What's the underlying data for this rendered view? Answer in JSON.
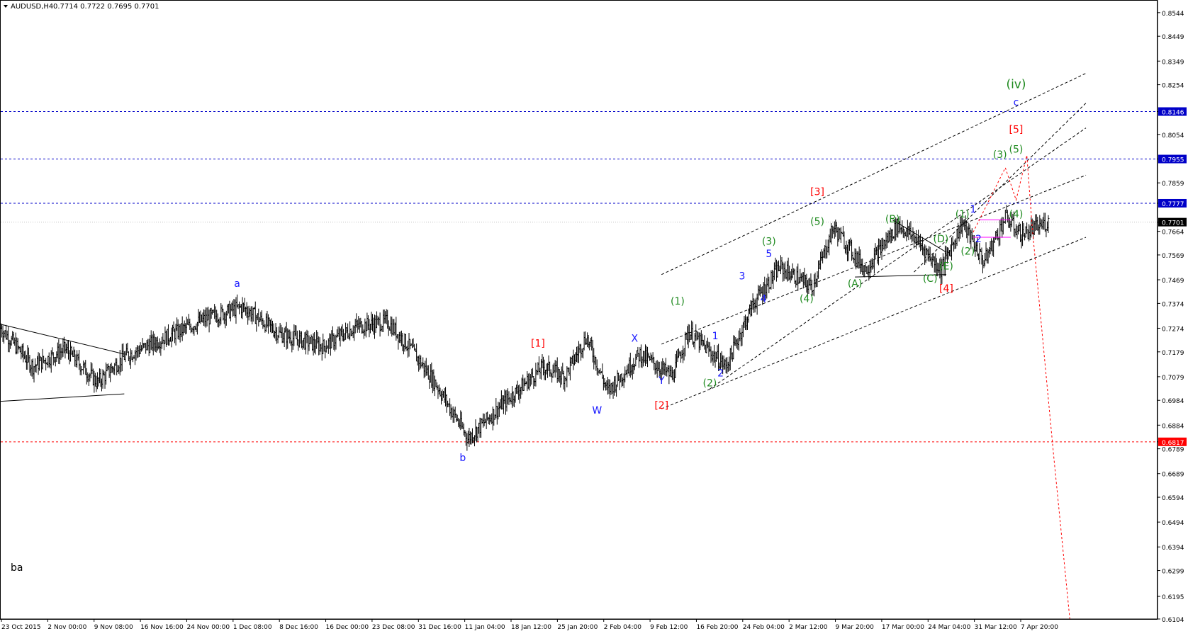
{
  "header": {
    "symbol": "AUDUSD,H4",
    "ohlc": "0.7714 0.7722 0.7695 0.7701"
  },
  "watermark": "ba",
  "colors": {
    "bars": "#000000",
    "hline_blue": "#0000c8",
    "hline_red": "#ff0000",
    "label_blue": "#1a1aff",
    "label_green": "#1f8a1f",
    "label_red": "#ff0000",
    "current_price_bg": "#000000",
    "highlight": "#ff00ff"
  },
  "chart_data": {
    "type": "candlestick-bars",
    "title": "AUDUSD,H4",
    "ylim": [
      0.6104,
      0.8592
    ],
    "y_ticks": [
      "0.8544",
      "0.8449",
      "0.8349",
      "0.8254",
      "0.8146",
      "0.8054",
      "0.7955",
      "0.7859",
      "0.7777",
      "0.7701",
      "0.7664",
      "0.7569",
      "0.7469",
      "0.7374",
      "0.7274",
      "0.7179",
      "0.7079",
      "0.6984",
      "0.6884",
      "0.6817",
      "0.6789",
      "0.6689",
      "0.6594",
      "0.6494",
      "0.6394",
      "0.6299",
      "0.6195",
      "0.6104"
    ],
    "x_ticks": [
      "23 Oct 2015",
      "2 Nov 00:00",
      "9 Nov 08:00",
      "16 Nov 16:00",
      "24 Nov 00:00",
      "1 Dec 08:00",
      "8 Dec 16:00",
      "16 Dec 00:00",
      "23 Dec 08:00",
      "31 Dec 16:00",
      "11 Jan 04:00",
      "18 Jan 12:00",
      "25 Jan 20:00",
      "2 Feb 04:00",
      "9 Feb 12:00",
      "16 Feb 20:00",
      "24 Feb 04:00",
      "2 Mar 12:00",
      "9 Mar 20:00",
      "17 Mar 00:00",
      "24 Mar 04:00",
      "31 Mar 12:00",
      "7 Apr 20:00"
    ],
    "price_series_knots": [
      {
        "t": 0,
        "p": 0.7275
      },
      {
        "t": 6,
        "p": 0.712
      },
      {
        "t": 12,
        "p": 0.719
      },
      {
        "t": 18,
        "p": 0.7055
      },
      {
        "t": 23,
        "p": 0.716
      },
      {
        "t": 30,
        "p": 0.723
      },
      {
        "t": 38,
        "p": 0.731
      },
      {
        "t": 45,
        "p": 0.736
      },
      {
        "t": 52,
        "p": 0.725
      },
      {
        "t": 60,
        "p": 0.72
      },
      {
        "t": 66,
        "p": 0.728
      },
      {
        "t": 72,
        "p": 0.73
      },
      {
        "t": 76,
        "p": 0.72
      },
      {
        "t": 81,
        "p": 0.705
      },
      {
        "t": 87,
        "p": 0.683
      },
      {
        "t": 93,
        "p": 0.696
      },
      {
        "t": 101,
        "p": 0.712
      },
      {
        "t": 105,
        "p": 0.708
      },
      {
        "t": 109,
        "p": 0.724
      },
      {
        "t": 113,
        "p": 0.702
      },
      {
        "t": 119,
        "p": 0.717
      },
      {
        "t": 125,
        "p": 0.708
      },
      {
        "t": 128,
        "p": 0.726
      },
      {
        "t": 135,
        "p": 0.712
      },
      {
        "t": 140,
        "p": 0.737
      },
      {
        "t": 145,
        "p": 0.752
      },
      {
        "t": 151,
        "p": 0.744
      },
      {
        "t": 155,
        "p": 0.768
      },
      {
        "t": 161,
        "p": 0.751
      },
      {
        "t": 167,
        "p": 0.769
      },
      {
        "t": 170,
        "p": 0.764
      },
      {
        "t": 175,
        "p": 0.751
      },
      {
        "t": 179,
        "p": 0.77
      },
      {
        "t": 183,
        "p": 0.754
      },
      {
        "t": 187,
        "p": 0.772
      },
      {
        "t": 190,
        "p": 0.765
      },
      {
        "t": 195,
        "p": 0.7701
      }
    ],
    "horizontal_levels": [
      {
        "price": 0.8146,
        "label": "0.8146",
        "style": "blue-dashed"
      },
      {
        "price": 0.7955,
        "label": "0.7955",
        "style": "blue-dashed"
      },
      {
        "price": 0.7777,
        "label": "0.7777",
        "style": "blue-dashed"
      },
      {
        "price": 0.7701,
        "label": "0.7701",
        "style": "current-price"
      },
      {
        "price": 0.6817,
        "label": "0.6817",
        "style": "red-dotted"
      }
    ],
    "wave_labels": [
      {
        "text": "a",
        "t": 44,
        "p": 0.744,
        "color": "blue"
      },
      {
        "text": "b",
        "t": 86,
        "p": 0.674,
        "color": "blue"
      },
      {
        "text": "[1]",
        "t": 100,
        "p": 0.72,
        "color": "red"
      },
      {
        "text": "W",
        "t": 111,
        "p": 0.693,
        "color": "blue"
      },
      {
        "text": "X",
        "t": 118,
        "p": 0.722,
        "color": "blue"
      },
      {
        "text": "Y",
        "t": 123,
        "p": 0.705,
        "color": "blue"
      },
      {
        "text": "[2]",
        "t": 123,
        "p": 0.695,
        "color": "red"
      },
      {
        "text": "(1)",
        "t": 126,
        "p": 0.737,
        "color": "green"
      },
      {
        "text": "1",
        "t": 133,
        "p": 0.723,
        "color": "blue"
      },
      {
        "text": "2",
        "t": 134,
        "p": 0.708,
        "color": "blue"
      },
      {
        "text": "(2)",
        "t": 132,
        "p": 0.704,
        "color": "green"
      },
      {
        "text": "3",
        "t": 138,
        "p": 0.747,
        "color": "blue"
      },
      {
        "text": "4",
        "t": 142,
        "p": 0.738,
        "color": "blue"
      },
      {
        "text": "5",
        "t": 143,
        "p": 0.756,
        "color": "blue"
      },
      {
        "text": "(3)",
        "t": 143,
        "p": 0.761,
        "color": "green"
      },
      {
        "text": "(4)",
        "t": 150,
        "p": 0.738,
        "color": "green"
      },
      {
        "text": "(5)",
        "t": 152,
        "p": 0.769,
        "color": "green"
      },
      {
        "text": "[3]",
        "t": 152,
        "p": 0.781,
        "color": "red"
      },
      {
        "text": "(A)",
        "t": 159,
        "p": 0.744,
        "color": "green"
      },
      {
        "text": "(B)",
        "t": 166,
        "p": 0.77,
        "color": "green"
      },
      {
        "text": "(C)",
        "t": 173,
        "p": 0.746,
        "color": "green"
      },
      {
        "text": "(D)",
        "t": 175,
        "p": 0.762,
        "color": "green"
      },
      {
        "text": "(E)",
        "t": 176,
        "p": 0.751,
        "color": "green"
      },
      {
        "text": "[4]",
        "t": 176,
        "p": 0.742,
        "color": "red"
      },
      {
        "text": "(1)",
        "t": 179,
        "p": 0.772,
        "color": "green"
      },
      {
        "text": "1",
        "t": 181,
        "p": 0.774,
        "color": "blue"
      },
      {
        "text": "(2)",
        "t": 180,
        "p": 0.757,
        "color": "green"
      },
      {
        "text": "2",
        "t": 182,
        "p": 0.762,
        "color": "blue"
      },
      {
        "text": "(3)",
        "t": 186,
        "p": 0.796,
        "color": "green"
      },
      {
        "text": "(4)",
        "t": 189,
        "p": 0.772,
        "color": "green"
      },
      {
        "text": "(5)",
        "t": 189,
        "p": 0.798,
        "color": "green"
      },
      {
        "text": "[5]",
        "t": 189,
        "p": 0.806,
        "color": "red"
      },
      {
        "text": "c",
        "t": 189,
        "p": 0.817,
        "color": "blue"
      },
      {
        "text": "(iv)",
        "t": 189,
        "p": 0.824,
        "color": "green"
      }
    ],
    "trend_lines": [
      {
        "t1": 0,
        "p1": 0.729,
        "t2": 23,
        "p2": 0.717,
        "style": "solid"
      },
      {
        "t1": 0,
        "p1": 0.698,
        "t2": 23,
        "p2": 0.701,
        "style": "solid"
      },
      {
        "t1": 166,
        "p1": 0.771,
        "t2": 176,
        "p2": 0.758,
        "style": "solid"
      },
      {
        "t1": 159,
        "p1": 0.748,
        "t2": 176,
        "p2": 0.749,
        "style": "solid"
      },
      {
        "t1": 123,
        "p1": 0.749,
        "t2": 202,
        "p2": 0.83,
        "style": "dashed"
      },
      {
        "t1": 123,
        "p1": 0.695,
        "t2": 202,
        "p2": 0.764,
        "style": "dashed"
      },
      {
        "t1": 123,
        "p1": 0.721,
        "t2": 202,
        "p2": 0.789,
        "style": "dashed"
      },
      {
        "t1": 132,
        "p1": 0.703,
        "t2": 202,
        "p2": 0.808,
        "style": "dashed"
      },
      {
        "t1": 170,
        "p1": 0.75,
        "t2": 202,
        "p2": 0.818,
        "style": "dashed"
      }
    ],
    "projection_path": [
      {
        "t": 181,
        "p": 0.766
      },
      {
        "t": 187,
        "p": 0.792
      },
      {
        "t": 189,
        "p": 0.779
      },
      {
        "t": 191,
        "p": 0.797
      },
      {
        "t": 192,
        "p": 0.768
      },
      {
        "t": 196,
        "p": 0.676
      },
      {
        "t": 199,
        "p": 0.6104
      }
    ]
  }
}
